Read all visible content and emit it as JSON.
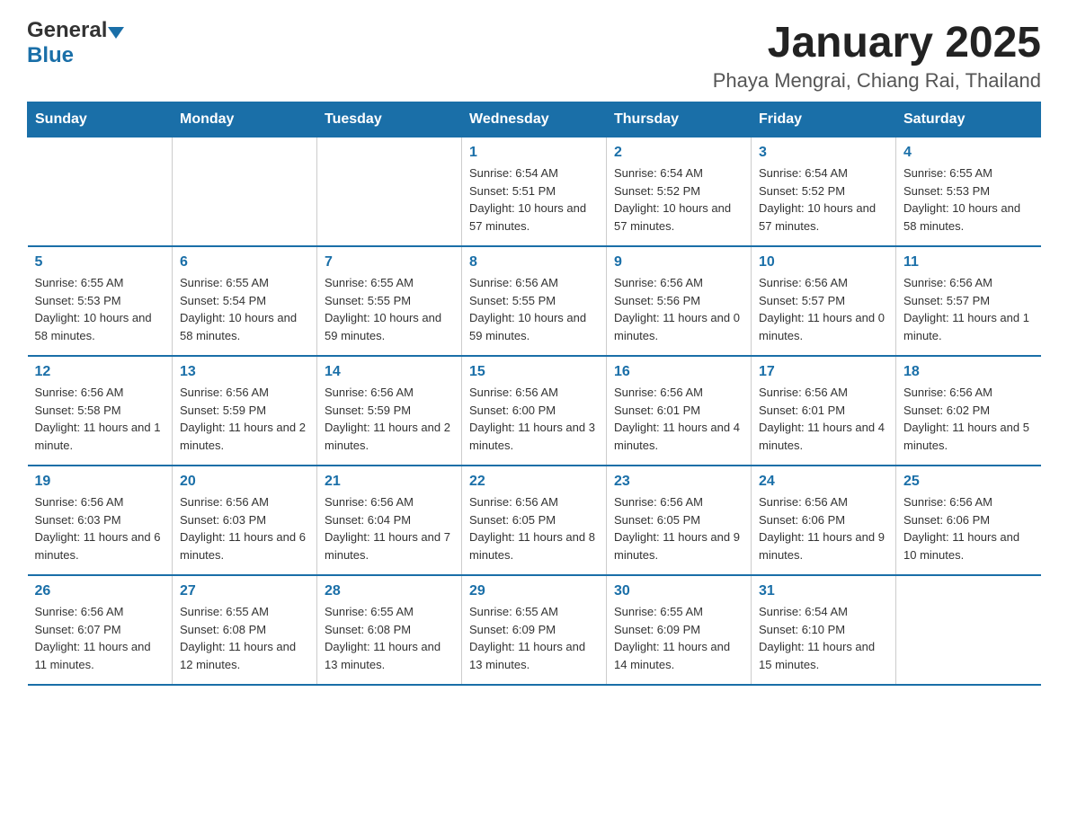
{
  "header": {
    "logo_general": "General",
    "logo_blue": "Blue",
    "main_title": "January 2025",
    "subtitle": "Phaya Mengrai, Chiang Rai, Thailand"
  },
  "weekdays": [
    "Sunday",
    "Monday",
    "Tuesday",
    "Wednesday",
    "Thursday",
    "Friday",
    "Saturday"
  ],
  "weeks": [
    [
      {
        "day": "",
        "sunrise": "",
        "sunset": "",
        "daylight": ""
      },
      {
        "day": "",
        "sunrise": "",
        "sunset": "",
        "daylight": ""
      },
      {
        "day": "",
        "sunrise": "",
        "sunset": "",
        "daylight": ""
      },
      {
        "day": "1",
        "sunrise": "Sunrise: 6:54 AM",
        "sunset": "Sunset: 5:51 PM",
        "daylight": "Daylight: 10 hours and 57 minutes."
      },
      {
        "day": "2",
        "sunrise": "Sunrise: 6:54 AM",
        "sunset": "Sunset: 5:52 PM",
        "daylight": "Daylight: 10 hours and 57 minutes."
      },
      {
        "day": "3",
        "sunrise": "Sunrise: 6:54 AM",
        "sunset": "Sunset: 5:52 PM",
        "daylight": "Daylight: 10 hours and 57 minutes."
      },
      {
        "day": "4",
        "sunrise": "Sunrise: 6:55 AM",
        "sunset": "Sunset: 5:53 PM",
        "daylight": "Daylight: 10 hours and 58 minutes."
      }
    ],
    [
      {
        "day": "5",
        "sunrise": "Sunrise: 6:55 AM",
        "sunset": "Sunset: 5:53 PM",
        "daylight": "Daylight: 10 hours and 58 minutes."
      },
      {
        "day": "6",
        "sunrise": "Sunrise: 6:55 AM",
        "sunset": "Sunset: 5:54 PM",
        "daylight": "Daylight: 10 hours and 58 minutes."
      },
      {
        "day": "7",
        "sunrise": "Sunrise: 6:55 AM",
        "sunset": "Sunset: 5:55 PM",
        "daylight": "Daylight: 10 hours and 59 minutes."
      },
      {
        "day": "8",
        "sunrise": "Sunrise: 6:56 AM",
        "sunset": "Sunset: 5:55 PM",
        "daylight": "Daylight: 10 hours and 59 minutes."
      },
      {
        "day": "9",
        "sunrise": "Sunrise: 6:56 AM",
        "sunset": "Sunset: 5:56 PM",
        "daylight": "Daylight: 11 hours and 0 minutes."
      },
      {
        "day": "10",
        "sunrise": "Sunrise: 6:56 AM",
        "sunset": "Sunset: 5:57 PM",
        "daylight": "Daylight: 11 hours and 0 minutes."
      },
      {
        "day": "11",
        "sunrise": "Sunrise: 6:56 AM",
        "sunset": "Sunset: 5:57 PM",
        "daylight": "Daylight: 11 hours and 1 minute."
      }
    ],
    [
      {
        "day": "12",
        "sunrise": "Sunrise: 6:56 AM",
        "sunset": "Sunset: 5:58 PM",
        "daylight": "Daylight: 11 hours and 1 minute."
      },
      {
        "day": "13",
        "sunrise": "Sunrise: 6:56 AM",
        "sunset": "Sunset: 5:59 PM",
        "daylight": "Daylight: 11 hours and 2 minutes."
      },
      {
        "day": "14",
        "sunrise": "Sunrise: 6:56 AM",
        "sunset": "Sunset: 5:59 PM",
        "daylight": "Daylight: 11 hours and 2 minutes."
      },
      {
        "day": "15",
        "sunrise": "Sunrise: 6:56 AM",
        "sunset": "Sunset: 6:00 PM",
        "daylight": "Daylight: 11 hours and 3 minutes."
      },
      {
        "day": "16",
        "sunrise": "Sunrise: 6:56 AM",
        "sunset": "Sunset: 6:01 PM",
        "daylight": "Daylight: 11 hours and 4 minutes."
      },
      {
        "day": "17",
        "sunrise": "Sunrise: 6:56 AM",
        "sunset": "Sunset: 6:01 PM",
        "daylight": "Daylight: 11 hours and 4 minutes."
      },
      {
        "day": "18",
        "sunrise": "Sunrise: 6:56 AM",
        "sunset": "Sunset: 6:02 PM",
        "daylight": "Daylight: 11 hours and 5 minutes."
      }
    ],
    [
      {
        "day": "19",
        "sunrise": "Sunrise: 6:56 AM",
        "sunset": "Sunset: 6:03 PM",
        "daylight": "Daylight: 11 hours and 6 minutes."
      },
      {
        "day": "20",
        "sunrise": "Sunrise: 6:56 AM",
        "sunset": "Sunset: 6:03 PM",
        "daylight": "Daylight: 11 hours and 6 minutes."
      },
      {
        "day": "21",
        "sunrise": "Sunrise: 6:56 AM",
        "sunset": "Sunset: 6:04 PM",
        "daylight": "Daylight: 11 hours and 7 minutes."
      },
      {
        "day": "22",
        "sunrise": "Sunrise: 6:56 AM",
        "sunset": "Sunset: 6:05 PM",
        "daylight": "Daylight: 11 hours and 8 minutes."
      },
      {
        "day": "23",
        "sunrise": "Sunrise: 6:56 AM",
        "sunset": "Sunset: 6:05 PM",
        "daylight": "Daylight: 11 hours and 9 minutes."
      },
      {
        "day": "24",
        "sunrise": "Sunrise: 6:56 AM",
        "sunset": "Sunset: 6:06 PM",
        "daylight": "Daylight: 11 hours and 9 minutes."
      },
      {
        "day": "25",
        "sunrise": "Sunrise: 6:56 AM",
        "sunset": "Sunset: 6:06 PM",
        "daylight": "Daylight: 11 hours and 10 minutes."
      }
    ],
    [
      {
        "day": "26",
        "sunrise": "Sunrise: 6:56 AM",
        "sunset": "Sunset: 6:07 PM",
        "daylight": "Daylight: 11 hours and 11 minutes."
      },
      {
        "day": "27",
        "sunrise": "Sunrise: 6:55 AM",
        "sunset": "Sunset: 6:08 PM",
        "daylight": "Daylight: 11 hours and 12 minutes."
      },
      {
        "day": "28",
        "sunrise": "Sunrise: 6:55 AM",
        "sunset": "Sunset: 6:08 PM",
        "daylight": "Daylight: 11 hours and 13 minutes."
      },
      {
        "day": "29",
        "sunrise": "Sunrise: 6:55 AM",
        "sunset": "Sunset: 6:09 PM",
        "daylight": "Daylight: 11 hours and 13 minutes."
      },
      {
        "day": "30",
        "sunrise": "Sunrise: 6:55 AM",
        "sunset": "Sunset: 6:09 PM",
        "daylight": "Daylight: 11 hours and 14 minutes."
      },
      {
        "day": "31",
        "sunrise": "Sunrise: 6:54 AM",
        "sunset": "Sunset: 6:10 PM",
        "daylight": "Daylight: 11 hours and 15 minutes."
      },
      {
        "day": "",
        "sunrise": "",
        "sunset": "",
        "daylight": ""
      }
    ]
  ]
}
